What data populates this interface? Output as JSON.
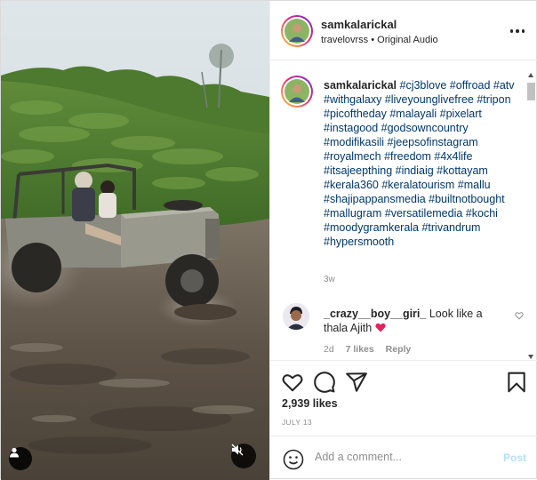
{
  "media": {
    "type": "video",
    "user_tag_icon": "person-icon",
    "audio_icon": "speaker-muted-icon"
  },
  "header": {
    "username": "samkalarickal",
    "location": "travelovrss",
    "separator": "•",
    "audio": "Original Audio",
    "more_icon": "more-horizontal-icon"
  },
  "caption": {
    "username": "samkalarickal",
    "hashtags": "#cj3blove #offroad #atv #withgalaxy #liveyounglivefree #tripon #picoftheday #malayali #pixelart #instagood #godsowncountry #modifikasili #jeepsofinstagram #royalmech #freedom #4x4life #itsajeepthing #indiaig #kottayam #kerala360 #keralatourism #mallu #shajipappansmedia #builtnotbought #mallugram #versatilemedia #kochi #moodygramkerala #trivandrum #hypersmooth",
    "time": "3w"
  },
  "comment": {
    "username": "_crazy__boy__giri_",
    "text": "Look like a thala Ajith",
    "emoji": "red-heart",
    "time": "2d",
    "likes": "7 likes",
    "reply": "Reply"
  },
  "actions": {
    "like_icon": "heart-icon",
    "comment_icon": "comment-icon",
    "share_icon": "share-icon",
    "save_icon": "bookmark-icon"
  },
  "likes": "2,939 likes",
  "date": "JULY 13",
  "add_comment": {
    "emoji_icon": "smiley-icon",
    "placeholder": "Add a comment...",
    "post_label": "Post"
  },
  "colors": {
    "link": "#00376b",
    "muted": "#8e8e8e",
    "post_disabled": "#b2dffc",
    "border": "#efefef"
  }
}
